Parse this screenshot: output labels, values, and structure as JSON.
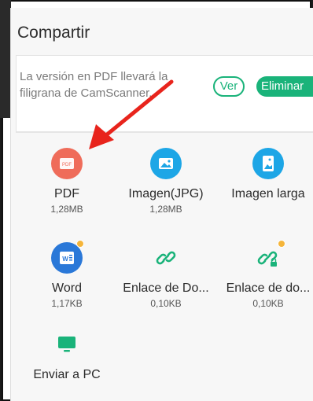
{
  "sheet": {
    "title": "Compartir"
  },
  "banner": {
    "text": "La versión en PDF llevará la filigrana de CamScanner.",
    "ver_label": "Ver",
    "eliminar_label": "Eliminar"
  },
  "options": [
    {
      "label": "PDF",
      "size": "1,28MB",
      "icon": "pdf-icon",
      "color": "#ef6c5a"
    },
    {
      "label": "Imagen(JPG)",
      "size": "1,28MB",
      "icon": "image-icon",
      "color": "#1da6e6"
    },
    {
      "label": "Imagen larga",
      "size": "",
      "icon": "long-image-icon",
      "color": "#1da6e6"
    },
    {
      "label": "Word",
      "size": "1,17KB",
      "icon": "word-icon",
      "color": "#2a78d8"
    },
    {
      "label": "Enlace de Do...",
      "size": "0,10KB",
      "icon": "link-icon",
      "color": "#1ab37a"
    },
    {
      "label": "Enlace de do...",
      "size": "0,10KB",
      "icon": "secure-link-icon",
      "color": "#1ab37a"
    },
    {
      "label": "Enviar a PC",
      "size": "",
      "icon": "monitor-icon",
      "color": "#1ab37a"
    }
  ],
  "colors": {
    "accent": "#1ab37a",
    "annotation_arrow": "#e8241c"
  }
}
